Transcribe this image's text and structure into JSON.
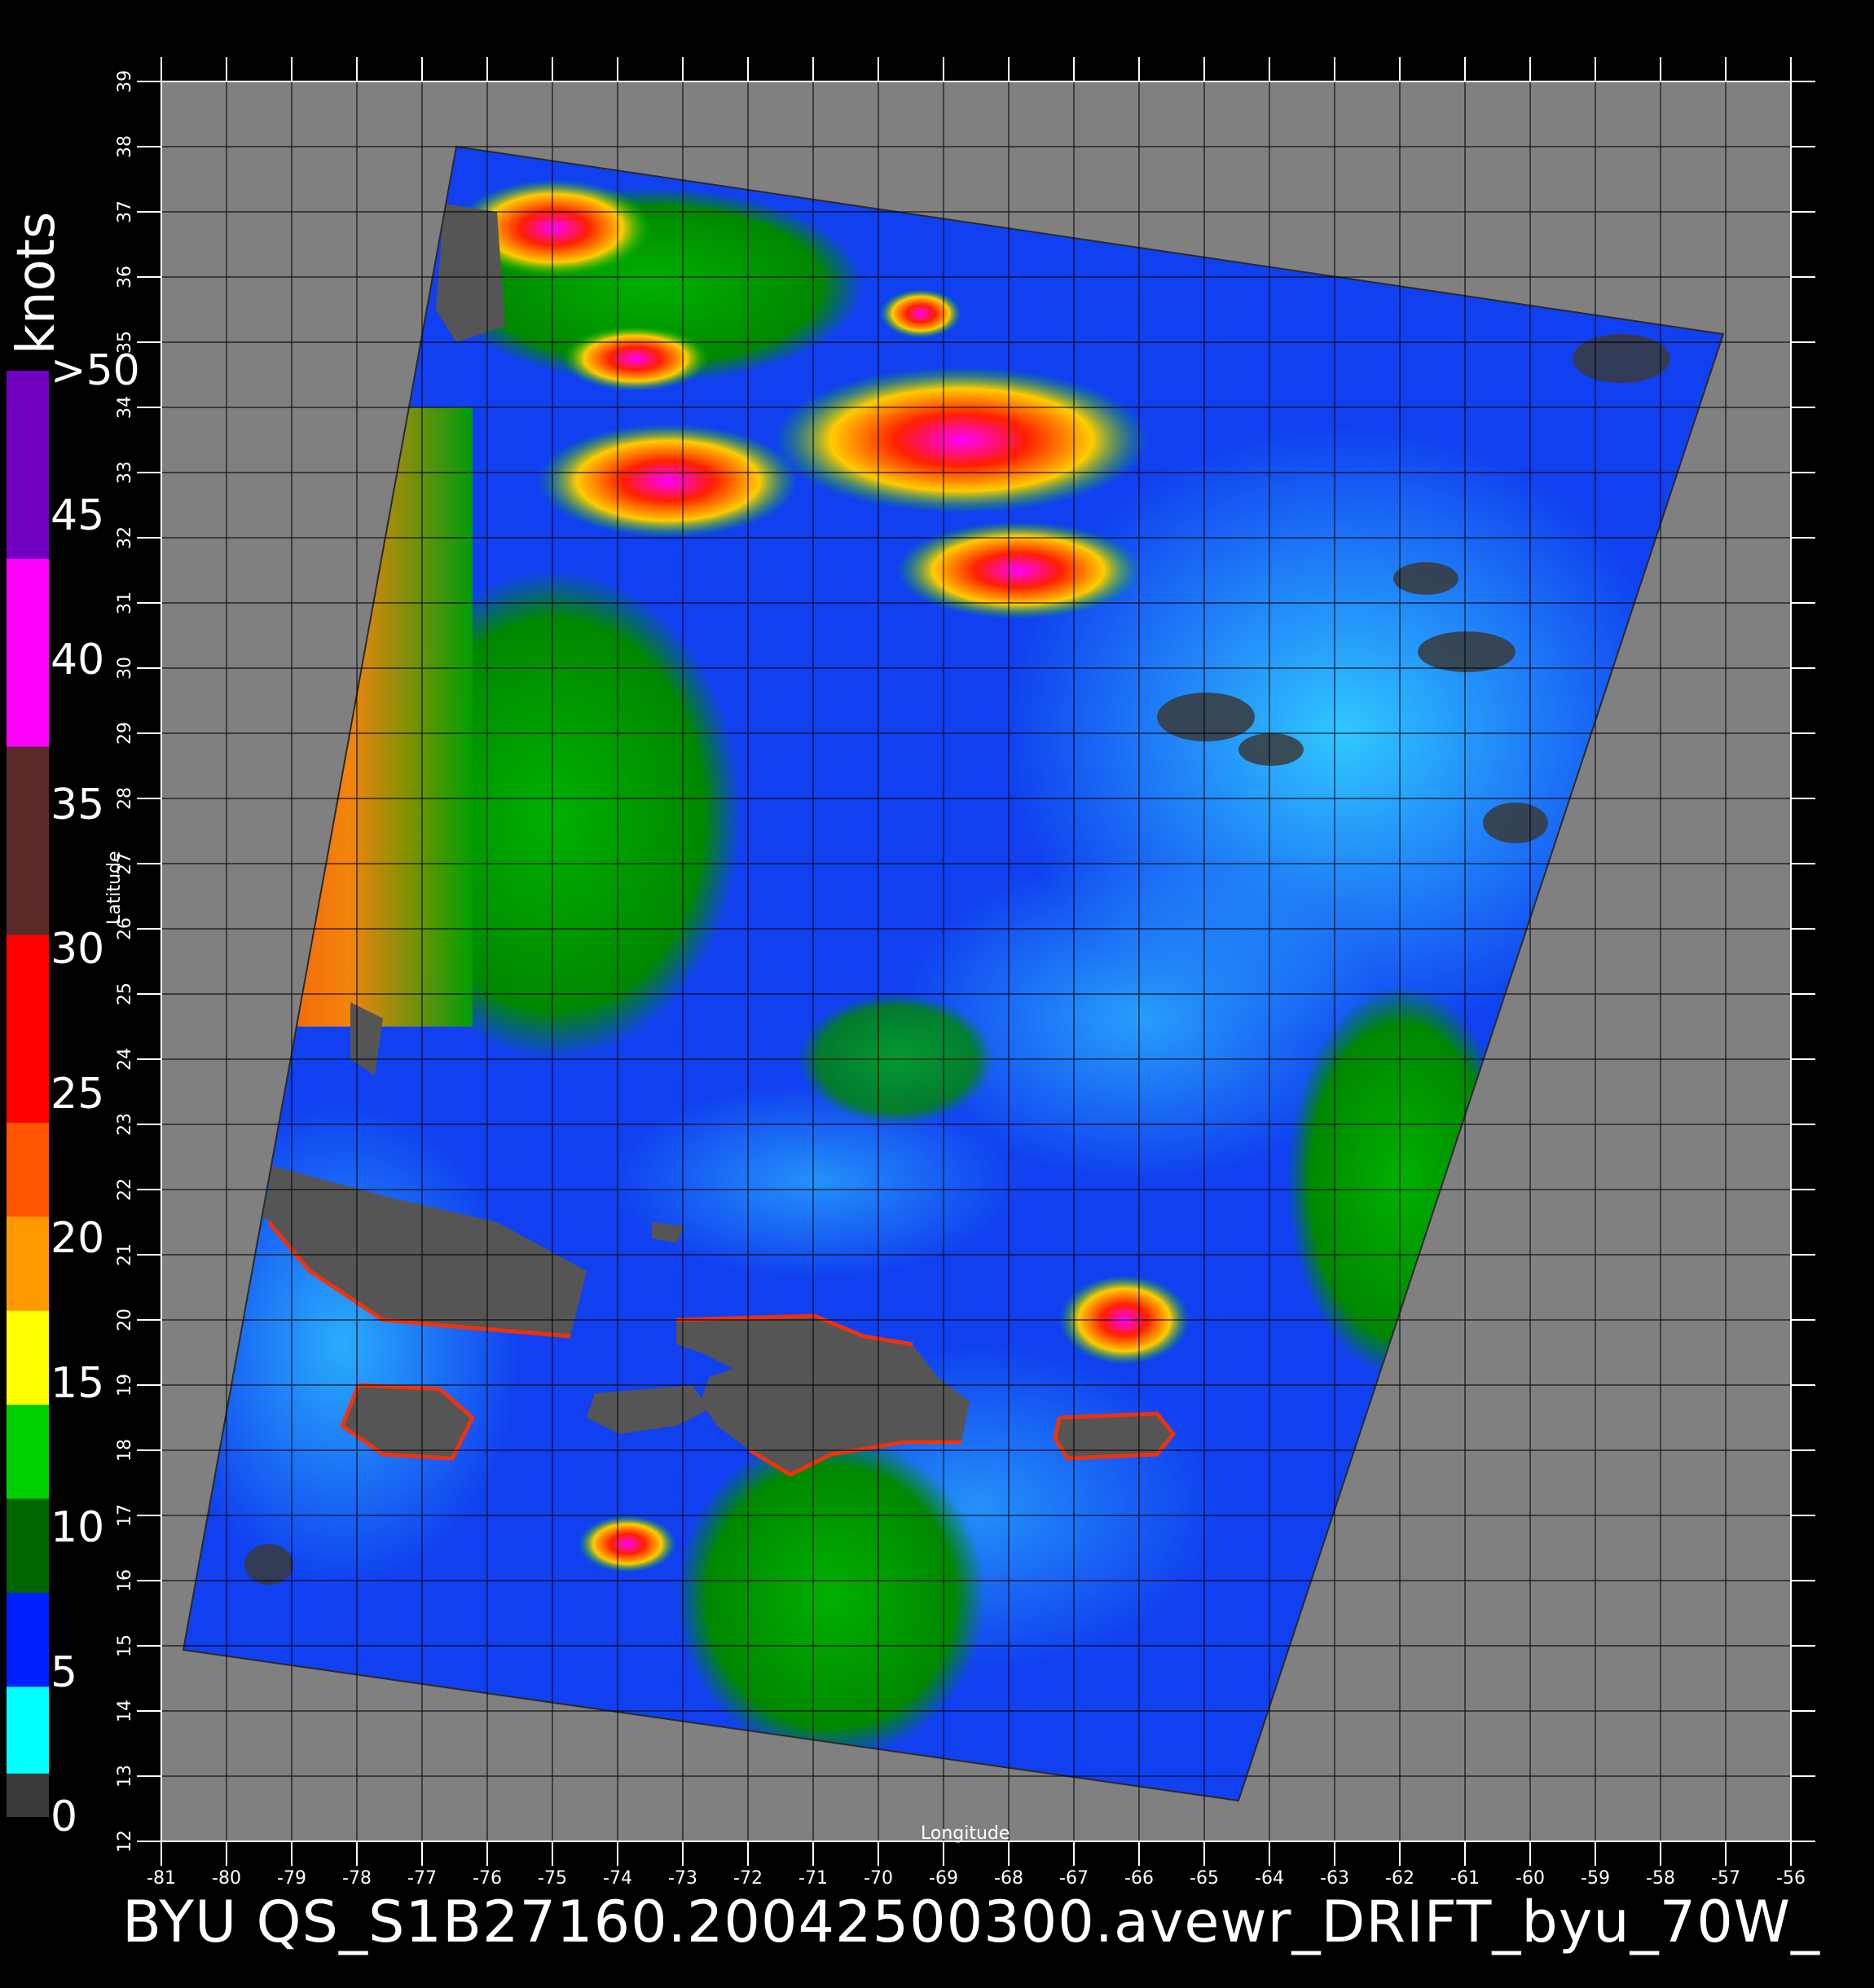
{
  "map": {
    "lon_ticks": [
      "-81",
      "-80",
      "-79",
      "-78",
      "-77",
      "-76",
      "-75",
      "-74",
      "-73",
      "-72",
      "-71",
      "-70",
      "-69",
      "-68",
      "-67",
      "-66",
      "-65",
      "-64",
      "-63",
      "-62",
      "-61",
      "-60",
      "-59",
      "-58",
      "-57",
      "-56"
    ],
    "lat_ticks": [
      "12",
      "13",
      "14",
      "15",
      "16",
      "17",
      "18",
      "19",
      "20",
      "21",
      "22",
      "23",
      "24",
      "25",
      "26",
      "27",
      "28",
      "29",
      "30",
      "31",
      "32",
      "33",
      "34",
      "35",
      "36",
      "37",
      "38",
      "39"
    ],
    "xlabel": "Longitude",
    "ylabel": "Latitude",
    "lon_range": [
      -81,
      -56
    ],
    "lat_range": [
      12,
      39
    ],
    "background_color": "#808080",
    "land_color": "#555555"
  },
  "colorbar": {
    "unit": "knots",
    "labels": [
      "0",
      "5",
      "10",
      "15",
      "20",
      "25",
      "30",
      "35",
      "40",
      "45",
      ">50"
    ],
    "colors": [
      "#3a3a3a",
      "#8a8a8a",
      "#00ffff",
      "#0060ff",
      "#0020ff",
      "#006400",
      "#00d000",
      "#ffff00",
      "#ff9900",
      "#ff5500",
      "#ff0000",
      "#c08060",
      "#5a2a2a",
      "#ff00ff",
      "#7000c0"
    ]
  },
  "title": "BYU  QS_S1B27160.20042500300.avewr_DRIFT_byu_70W_"
}
